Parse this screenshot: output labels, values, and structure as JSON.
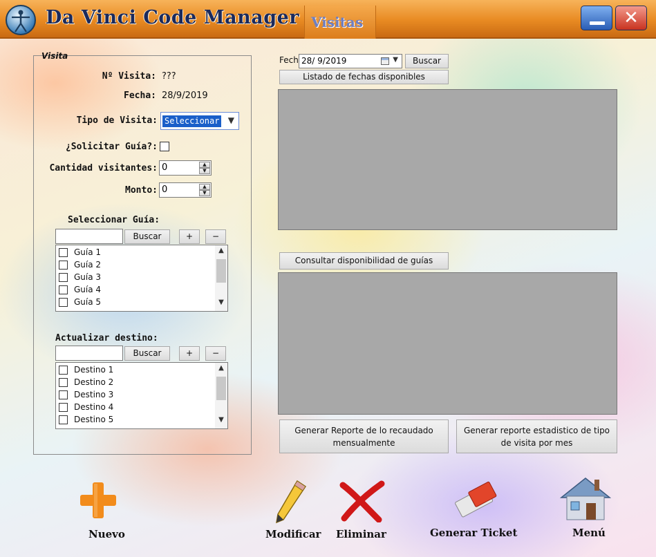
{
  "window": {
    "app_title": "Da Vinci Code Manager",
    "section_title": "Visitas",
    "minimize_label": "—",
    "close_label": "✕"
  },
  "visita": {
    "group_title": "Visita",
    "numero_label": "Nº Visita:",
    "numero_value": "???",
    "fecha_label": "Fecha:",
    "fecha_value": "28/9/2019",
    "tipo_label": "Tipo de Visita:",
    "tipo_selected": "Seleccionar",
    "solicitar_guia_label": "¿Solicitar Guía?:",
    "solicitar_guia_checked": false,
    "cantidad_label": "Cantidad visitantes:",
    "cantidad_value": "0",
    "monto_label": "Monto:",
    "monto_value": "0"
  },
  "guias": {
    "title": "Seleccionar Guía:",
    "search_value": "",
    "search_button": "Buscar",
    "add_button": "+",
    "remove_button": "−",
    "items": [
      "Guía 1",
      "Guía 2",
      "Guía 3",
      "Guía 4",
      "Guía 5"
    ]
  },
  "destinos": {
    "title": "Actualizar destino:",
    "search_value": "",
    "search_button": "Buscar",
    "add_button": "+",
    "remove_button": "−",
    "items": [
      "Destino 1",
      "Destino 2",
      "Destino 3",
      "Destino 4",
      "Destino 5"
    ]
  },
  "fecha_search": {
    "label": "Fecha:",
    "value": "28/ 9/2019",
    "search_button": "Buscar",
    "list_button": "Listado de fechas disponibles"
  },
  "guias_panel": {
    "consult_button": "Consultar disponibilidad de guías"
  },
  "reports": {
    "monthly_button": "Generar Reporte de lo recaudado mensualmente",
    "stats_button": "Generar reporte estadistico de tipo de visita por mes"
  },
  "actions": {
    "nuevo": "Nuevo",
    "modificar": "Modificar",
    "eliminar": "Eliminar",
    "generar_ticket": "Generar Ticket",
    "menu": "Menú"
  },
  "icons": {
    "logo": "vitruvian-man-logo",
    "nuevo": "plus-icon",
    "modificar": "pencil-icon",
    "eliminar": "x-mark-icon",
    "ticket": "ticket-icon",
    "menu": "house-icon"
  },
  "colors": {
    "titlebar": "#e88a22",
    "panel_gray": "#a8a8a8",
    "selection_blue": "#1a5fc9",
    "plus_orange": "#f28c1c",
    "delete_red": "#d01818"
  }
}
